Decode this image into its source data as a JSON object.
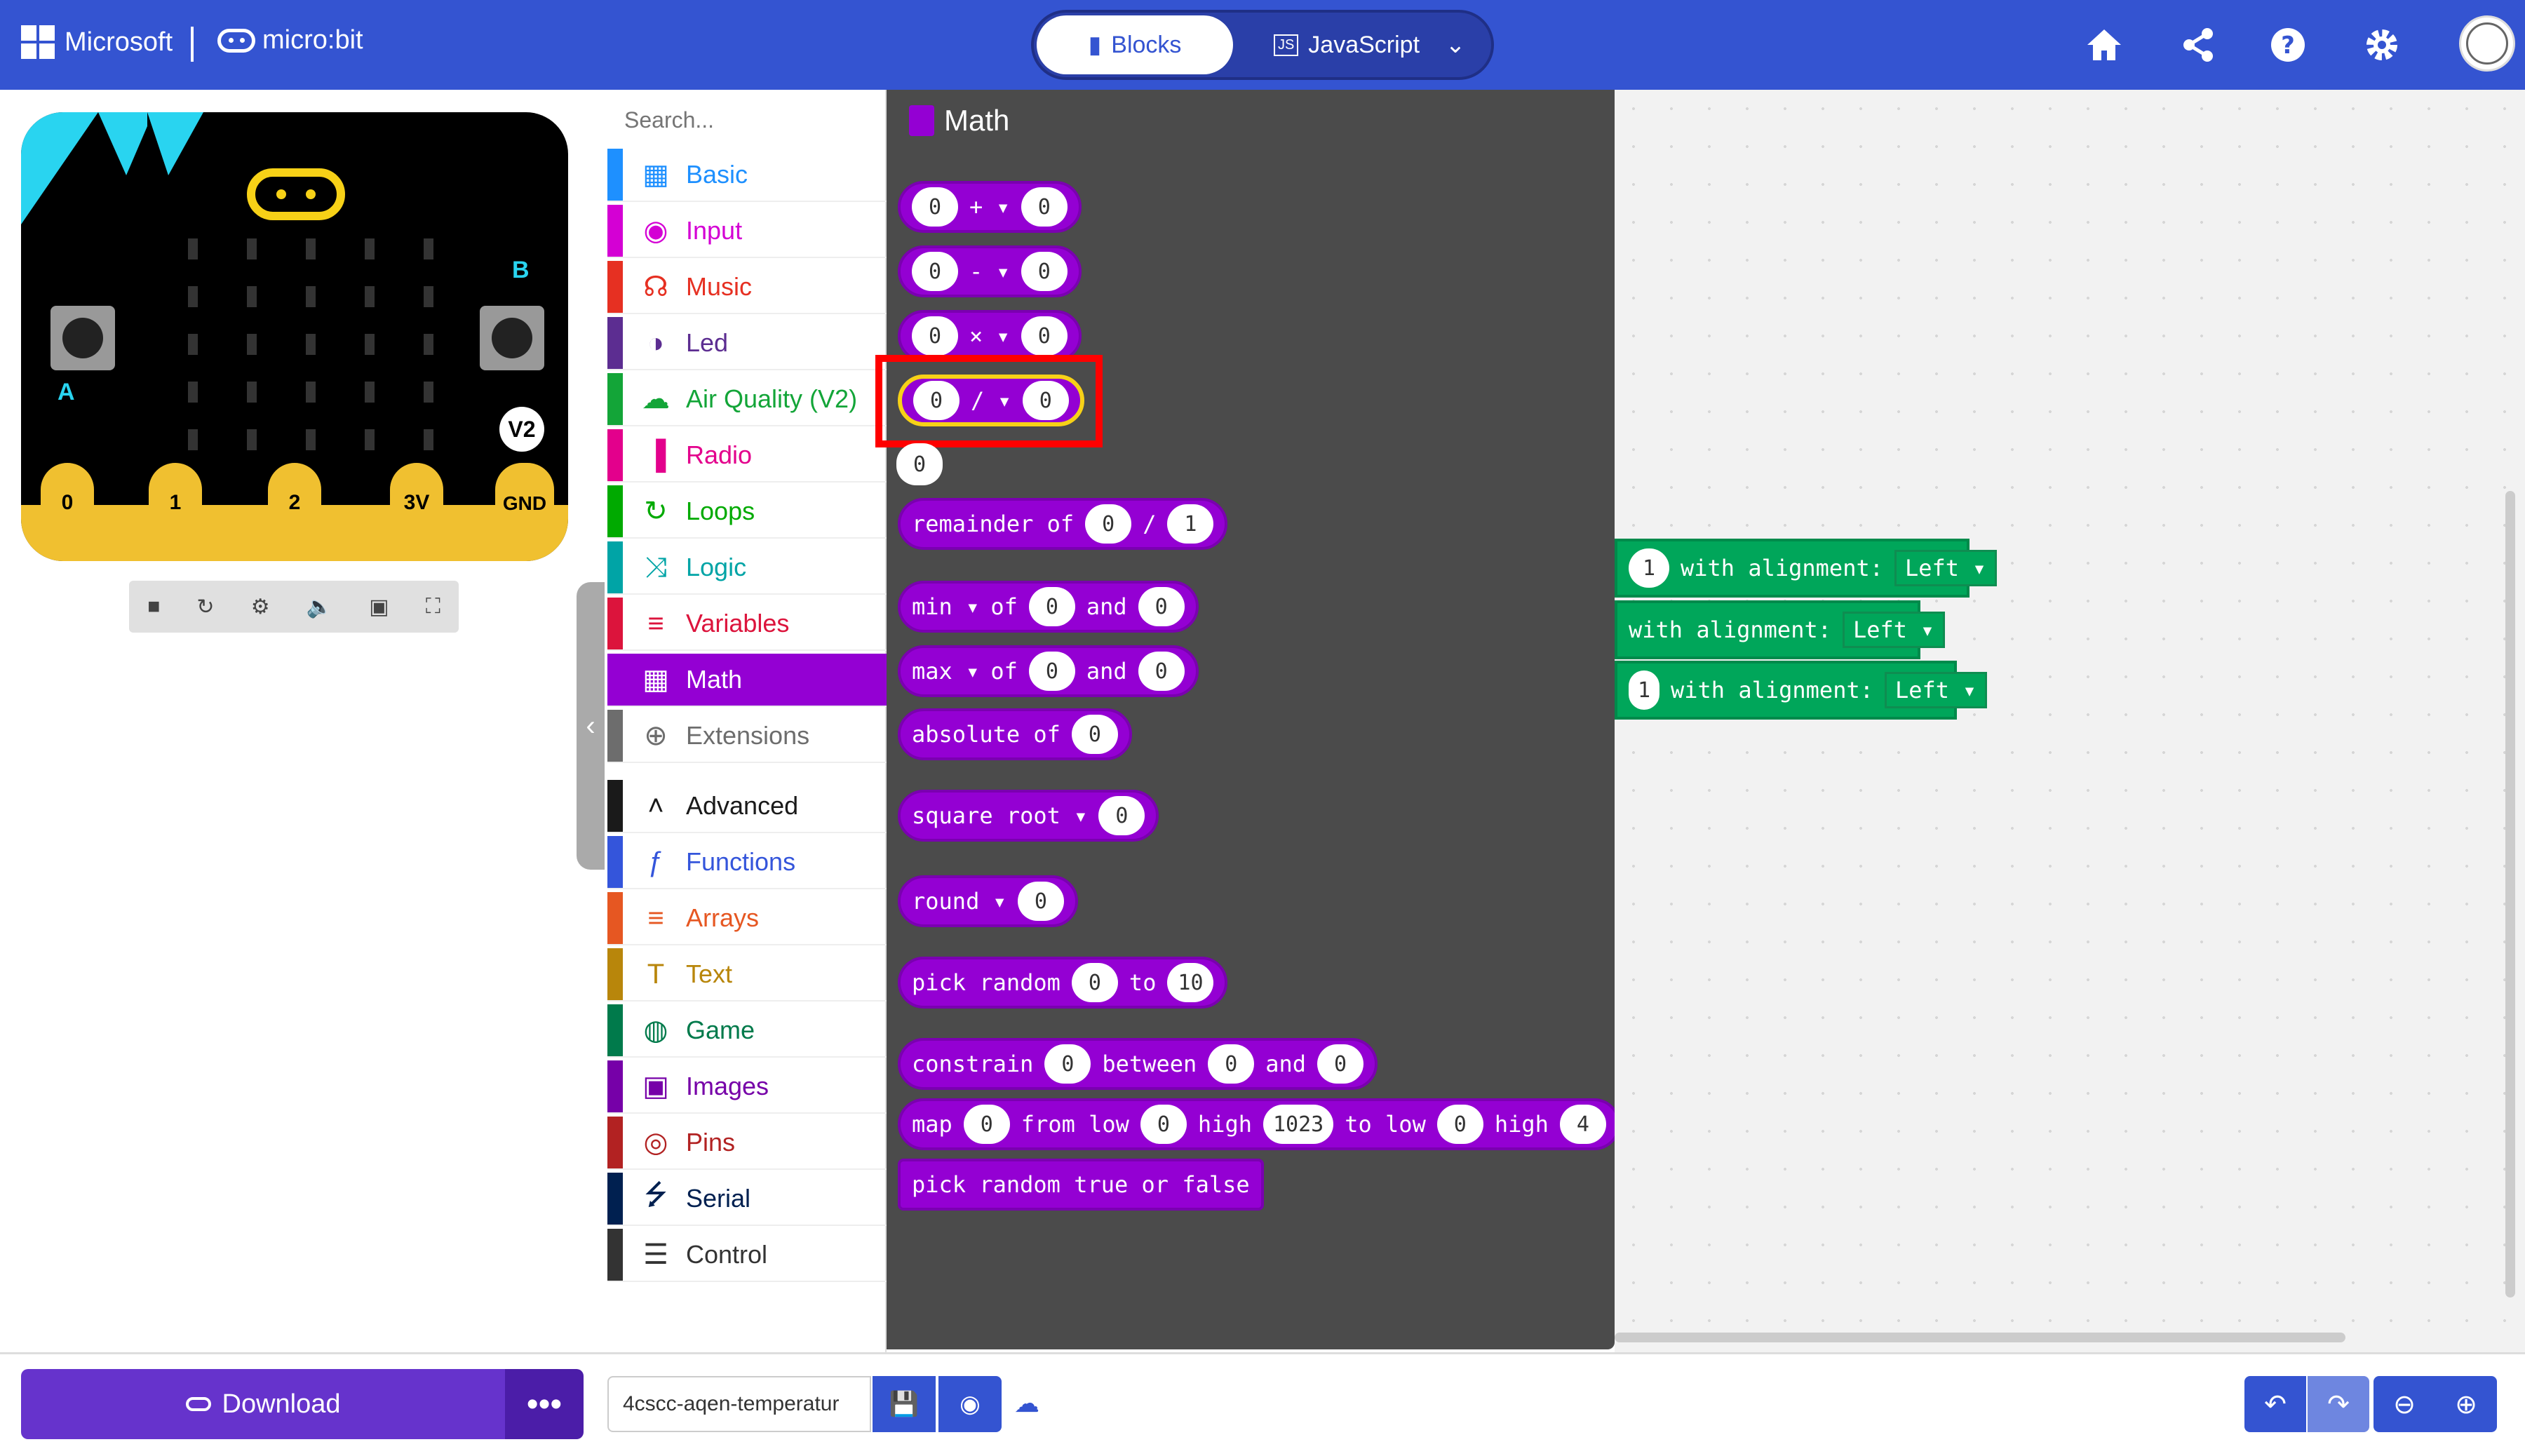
{
  "header": {
    "brand": "Microsoft",
    "product": "micro:bit",
    "tabs": [
      {
        "label": "Blocks",
        "selected": true
      },
      {
        "label": "JavaScript",
        "selected": false
      }
    ]
  },
  "simulator": {
    "pins": [
      "0",
      "1",
      "2",
      "3V",
      "GND"
    ],
    "version_badge": "V2",
    "button_a": "A",
    "button_b": "B"
  },
  "toolbox": {
    "search_placeholder": "Search...",
    "categories": [
      {
        "label": "Basic",
        "color": "#1e90ff",
        "icon": "grid-icon"
      },
      {
        "label": "Input",
        "color": "#d400d4",
        "icon": "input-icon"
      },
      {
        "label": "Music",
        "color": "#e63022",
        "icon": "headphones-icon"
      },
      {
        "label": "Led",
        "color": "#5c2d91",
        "icon": "toggle-icon"
      },
      {
        "label": "Air Quality (V2)",
        "color": "#13a538",
        "icon": "cloud-icon"
      },
      {
        "label": "Radio",
        "color": "#e3008c",
        "icon": "signal-icon"
      },
      {
        "label": "Loops",
        "color": "#00aa00",
        "icon": "loop-icon"
      },
      {
        "label": "Logic",
        "color": "#00a4a6",
        "icon": "shuffle-icon"
      },
      {
        "label": "Variables",
        "color": "#dc143c",
        "icon": "list-icon"
      },
      {
        "label": "Math",
        "color": "#9400d3",
        "icon": "calculator-icon",
        "selected": true
      },
      {
        "label": "Extensions",
        "color": "#6d6d6d",
        "icon": "plus-circle-icon"
      },
      {
        "label": "Advanced",
        "color": "#1a1a1a",
        "icon": "chevron-up-icon"
      },
      {
        "label": "Functions",
        "color": "#3455db",
        "icon": "function-icon"
      },
      {
        "label": "Arrays",
        "color": "#e65722",
        "icon": "list-icon"
      },
      {
        "label": "Text",
        "color": "#b8860b",
        "icon": "text-icon"
      },
      {
        "label": "Game",
        "color": "#007a4b",
        "icon": "gamepad-icon"
      },
      {
        "label": "Images",
        "color": "#7600a8",
        "icon": "image-icon"
      },
      {
        "label": "Pins",
        "color": "#b22222",
        "icon": "target-icon"
      },
      {
        "label": "Serial",
        "color": "#002050",
        "icon": "usb-icon"
      },
      {
        "label": "Control",
        "color": "#333333",
        "icon": "control-icon"
      }
    ]
  },
  "flyout": {
    "title": "Math",
    "blocks": {
      "add": {
        "a": "0",
        "op": "+",
        "b": "0"
      },
      "sub": {
        "a": "0",
        "op": "-",
        "b": "0"
      },
      "mul": {
        "a": "0",
        "op": "×",
        "b": "0"
      },
      "div": {
        "a": "0",
        "op": "/",
        "b": "0"
      },
      "number": "0",
      "remainder": {
        "label": "remainder of",
        "a": "0",
        "sep": "/",
        "b": "1"
      },
      "min": {
        "fn": "min",
        "of": "of",
        "a": "0",
        "and": "and",
        "b": "0"
      },
      "max": {
        "fn": "max",
        "of": "of",
        "a": "0",
        "and": "and",
        "b": "0"
      },
      "absolute": {
        "label": "absolute of",
        "a": "0"
      },
      "sqrt": {
        "fn": "square root",
        "a": "0"
      },
      "round": {
        "fn": "round",
        "a": "0"
      },
      "random": {
        "label": "pick random",
        "a": "0",
        "to": "to",
        "b": "10"
      },
      "constrain": {
        "label": "constrain",
        "a": "0",
        "between": "between",
        "b": "0",
        "and": "and",
        "c": "0"
      },
      "map": {
        "label": "map",
        "a": "0",
        "from_low": "from low",
        "b": "0",
        "high1": "high",
        "c": "1023",
        "to_low": "to low",
        "d": "0",
        "high2": "high",
        "e": "4"
      },
      "random_bool": "pick random true or false"
    }
  },
  "workspace": {
    "blocks": [
      {
        "value": "1",
        "label": "with alignment:",
        "option": "Left"
      },
      {
        "value": "",
        "label": "with alignment:",
        "option": "Left"
      },
      {
        "value": "1",
        "label": "with alignment:",
        "option": "Left"
      }
    ]
  },
  "bottom": {
    "download_label": "Download",
    "project_name": "4cscc-aqen-temperatur"
  }
}
